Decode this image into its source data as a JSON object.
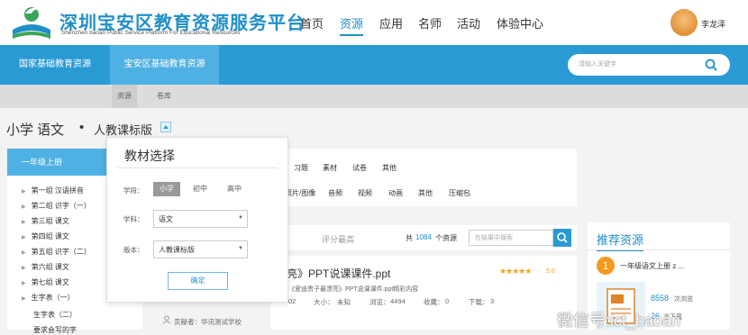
{
  "header": {
    "logo_title": "深圳宝安区教育资源服务平台",
    "logo_subtitle": "Shenzhen baoan Public Service Platform For Educational Resources",
    "nav": [
      {
        "label": "首页",
        "active": false
      },
      {
        "label": "资源",
        "active": true
      },
      {
        "label": "应用",
        "active": false
      },
      {
        "label": "名师",
        "active": false
      },
      {
        "label": "活动",
        "active": false
      },
      {
        "label": "体验中心",
        "active": false
      }
    ],
    "username": "李龙泽"
  },
  "tabs": [
    "国家基础教育资源",
    "宝安区基础教育资源"
  ],
  "search": {
    "placeholder": "请输入关键字"
  },
  "subtabs": [
    "资源",
    "卷库"
  ],
  "breadcrumb": {
    "subject": "小学 语文",
    "separator": "•",
    "edition": "人教课标版"
  },
  "sidebar": {
    "head": "一年级上册",
    "items": [
      "第一组 汉语拼音",
      "第二组 识字（一）",
      "第三组 课文",
      "第四组 课文",
      "第五组 识字（二）",
      "第六组 课文",
      "第七组 课文",
      "生字表（一）",
      "生字表（二）",
      "要求会写的字"
    ]
  },
  "filters": {
    "row1": [
      "习题",
      "素材",
      "试卷",
      "其他"
    ],
    "row2": [
      "照片/图像",
      "音频",
      "视频",
      "动画",
      "其他",
      "压缩包"
    ]
  },
  "list": {
    "sort_label": "评分最高",
    "total_prefix": "共",
    "total_count": "1084",
    "total_suffix": "个资源",
    "search_placeholder": "在结果中搜索"
  },
  "item": {
    "title": "亮》PPT说课课件.ppt",
    "rating": 5,
    "score": "5.0",
    "desc": "《爱迪贵子最漂亮》PPT说课课件.ppt精彩内容",
    "date": "02",
    "size_label": "大小：",
    "size": "未知",
    "views_label": "浏览：",
    "views": "4494",
    "fav_label": "收藏：",
    "fav": "0",
    "dl_label": "下载：",
    "dl": "3",
    "uploader": "贡献者：华讯测试学校"
  },
  "popup": {
    "title": "教材选择",
    "stage_label": "学段：",
    "stages": [
      "小学",
      "初中",
      "高中"
    ],
    "selected_stage": "小学",
    "subject_label": "学科：",
    "subject_value": "语文",
    "edition_label": "版本：",
    "edition_value": "人教课标版",
    "ok_label": "确定"
  },
  "recommend": {
    "title": "推荐资源",
    "rank": "1",
    "name": "一年级语文上册 z ...",
    "views": "8558",
    "views_label": "次浏览",
    "downloads": "26",
    "downloads_label": "次下载"
  },
  "watermark": "微信号:ict_baoan",
  "colors": {
    "brand": "#2a9ad5",
    "brand_light": "#4fb0e3",
    "star": "#f4a21b",
    "rank": "#f39a1e"
  }
}
